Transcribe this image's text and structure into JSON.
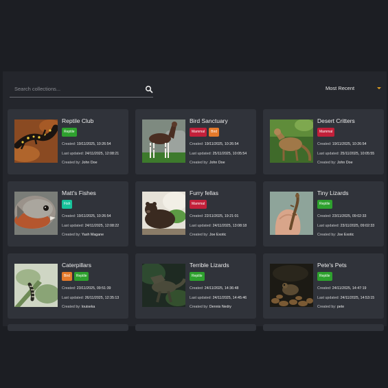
{
  "search": {
    "placeholder": "Search collections..."
  },
  "sort": {
    "selected": "Most Recent"
  },
  "labels": {
    "created": "Created: ",
    "updated": "Last updated: ",
    "by": "Created by: "
  },
  "cards": [
    {
      "title": "Reptile Club",
      "tags": [
        "Reptile"
      ],
      "created": "19/11/2025, 10:26:54",
      "updated": "24/11/2025, 12:08:21",
      "by": "John Doe"
    },
    {
      "title": "Bird Sanctuary",
      "tags": [
        "Mammal",
        "Bird"
      ],
      "created": "19/11/2025, 10:26:54",
      "updated": "25/11/2025, 10:05:54",
      "by": "John Doe"
    },
    {
      "title": "Desert Critters",
      "tags": [
        "Mammal"
      ],
      "created": "19/11/2025, 10:26:54",
      "updated": "25/11/2025, 10:05:55",
      "by": "John Doe"
    },
    {
      "title": "Matt's Fishes",
      "tags": [
        "Fish"
      ],
      "created": "19/11/2025, 10:26:54",
      "updated": "24/11/2025, 12:08:22",
      "by": "Yash Magane"
    },
    {
      "title": "Furry fellas",
      "tags": [
        "Mammal"
      ],
      "created": "22/11/2025, 19:21:01",
      "updated": "24/11/2025, 13:08:18",
      "by": "Joe Exotic"
    },
    {
      "title": "Tiny Lizards",
      "tags": [
        "Reptile"
      ],
      "created": "23/11/2025, 09:02:33",
      "updated": "23/11/2025, 09:02:33",
      "by": "Joe Exotic"
    },
    {
      "title": "Caterpillars",
      "tags": [
        "Bird",
        "Reptile"
      ],
      "created": "23/11/2025, 09:51:39",
      "updated": "26/11/2025, 12:35:13",
      "by": "louiseka"
    },
    {
      "title": "Terrible Lizards",
      "tags": [
        "Reptile"
      ],
      "created": "24/11/2025, 14:36:48",
      "updated": "24/11/2025, 14:45:46",
      "by": "Dennis Nedry"
    },
    {
      "title": "Pete's Pets",
      "tags": [
        "Reptile"
      ],
      "created": "24/11/2025, 14:47:19",
      "updated": "24/11/2025, 14:53:15",
      "by": "pete"
    }
  ],
  "colors": {
    "reptile": "#2ea12e",
    "mammal": "#c2203a",
    "bird": "#e47a2b",
    "fish": "#17c29a",
    "accent": "#e0a020"
  }
}
